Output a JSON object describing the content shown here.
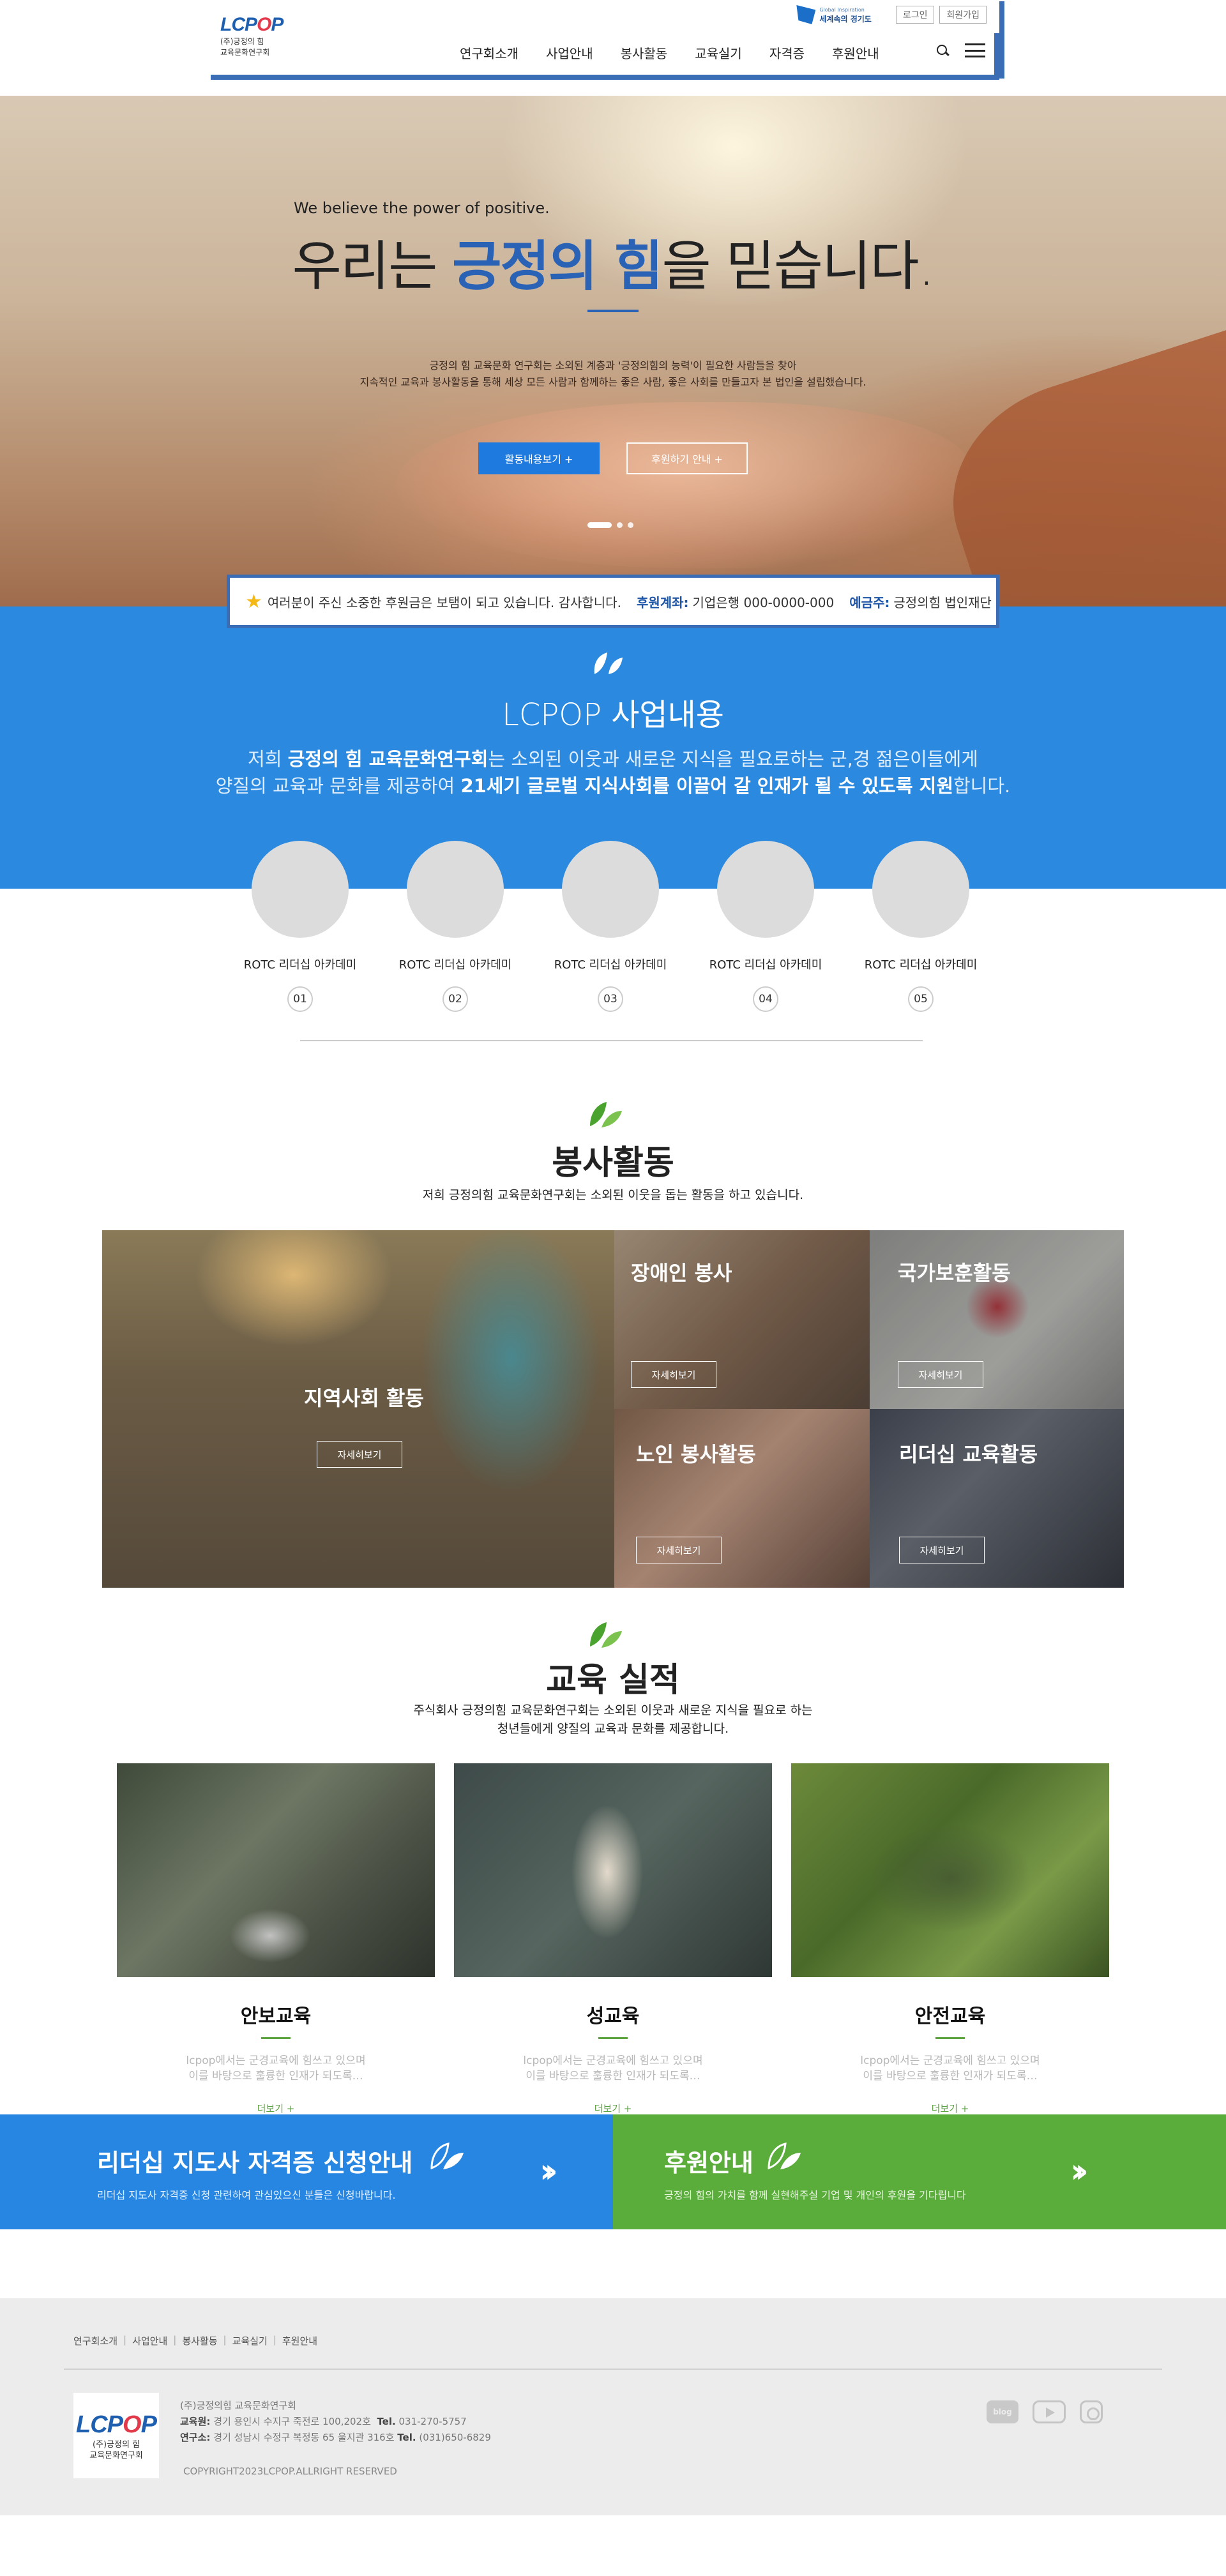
{
  "header": {
    "logo_main_1": "LCP",
    "logo_main_o": "O",
    "logo_main_2": "P",
    "logo_sub_1": "(주)긍정의 힘",
    "logo_sub_2": "교육문화연구회",
    "gyeonggi_small": "Global Inspiration",
    "gyeonggi_name": "세계속의 경기도",
    "login": "로그인",
    "signup": "회원가입",
    "nav": [
      "연구회소개",
      "사업안내",
      "봉사활동",
      "교육실기",
      "자격증",
      "후원안내"
    ]
  },
  "hero": {
    "eyebrow": "We believe the power of positive.",
    "title_pre": "우리는 ",
    "title_emph": "긍정의 힘",
    "title_post": "을 믿습니다.",
    "desc_1": "긍정의 힘 교육문화 연구회는 소외된 계층과 '긍정의힘의 능력'이 필요한 사람들을 찾아",
    "desc_2": "지속적인 교육과 봉사활동을 통해 세상 모든 사람과 함께하는 좋은 사람, 좋은 사회를 만들고자 본 법인을 설립했습니다.",
    "btn_activity": "활동내용보기 +",
    "btn_donate": "후원하기 안내 +"
  },
  "notice": {
    "text": "여러분이 주신 소중한 후원금은 보탬이 되고 있습니다. 감사합니다.",
    "account_label": "후원계좌:",
    "account_value": "기업은행 000-0000-000",
    "holder_label": "예금주:",
    "holder_value": "긍정의힘 법인재단"
  },
  "business": {
    "title": "LCPOP 사업내용",
    "line1_a": "저희 ",
    "line1_b": "긍정의 힘 교육문화연구회",
    "line1_c": "는 소외된 이웃과 새로운 지식을 필요로하는 군,경 젊은이들에게",
    "line2_a": "양질의 교육과 문화를 제공하여 ",
    "line2_b": "21세기 글로벌 지식사회를 이끌어 갈 인재가 될 수 있도록 지원",
    "line2_c": "합니다.",
    "items": [
      {
        "label": "ROTC 리더십 아카데미",
        "num": "01"
      },
      {
        "label": "ROTC 리더십 아카데미",
        "num": "02"
      },
      {
        "label": "ROTC 리더십 아카데미",
        "num": "03"
      },
      {
        "label": "ROTC 리더십 아카데미",
        "num": "04"
      },
      {
        "label": "ROTC 리더십 아카데미",
        "num": "05"
      }
    ]
  },
  "volunteer": {
    "title": "봉사활동",
    "subtitle": "저희 긍정의힘 교육문화연구회는 소외된 이웃을 돕는 활동을 하고 있습니다.",
    "tiles": [
      {
        "title": "지역사회 활동",
        "btn": "자세히보기"
      },
      {
        "title": "장애인 봉사",
        "btn": "자세히보기"
      },
      {
        "title": "국가보훈활동",
        "btn": "자세히보기"
      },
      {
        "title": "노인 봉사활동",
        "btn": "자세히보기"
      },
      {
        "title": "리더십 교육활동",
        "btn": "자세히보기"
      }
    ]
  },
  "education": {
    "title": "교육 실적",
    "sub_1": "주식회사 긍정의힘 교육문화연구회는 소외된 이웃과 새로운 지식을 필요로 하는",
    "sub_2": "청년들에게 양질의 교육과 문화를 제공합니다.",
    "cards": [
      {
        "name": "안보교육",
        "text_1": "lcpop에서는 군경교육에 힘쓰고 있으며",
        "text_2": "이를 바탕으로 훌륭한 인재가 되도록…",
        "more": "더보기 +"
      },
      {
        "name": "성교육",
        "text_1": "lcpop에서는 군경교육에 힘쓰고 있으며",
        "text_2": "이를 바탕으로 훌륭한 인재가 되도록…",
        "more": "더보기 +"
      },
      {
        "name": "안전교육",
        "text_1": "lcpop에서는 군경교육에 힘쓰고 있으며",
        "text_2": "이를 바탕으로 훌륭한 인재가 되도록…",
        "more": "더보기 +"
      }
    ]
  },
  "banners": {
    "cert_title": "리더십 지도사 자격증 신청안내",
    "cert_sub": "리더십 지도사 자격증 신청 관련하여 관심있으신 분들은 신청바랍니다.",
    "donate_title": "후원안내",
    "donate_sub": "긍정의 힘의 가치를 함께 실현해주실 기업 및 개인의 후원을 기다립니다"
  },
  "footer": {
    "links": [
      "연구회소개",
      "사업안내",
      "봉사활동",
      "교육실기",
      "후원안내"
    ],
    "company": "(주)긍정의힘 교육문화연구회",
    "edu_label": "교육원:",
    "edu_addr": "경기 용인시 수지구 죽전로 100,202호",
    "edu_tel_label": "Tel.",
    "edu_tel": "031-270-5757",
    "lab_label": "연구소:",
    "lab_addr": "경기 성남시 수정구 복정동 65 울지관 316호",
    "lab_tel_label": "Tel.",
    "lab_tel": "(031)650-6829",
    "copyright": "COPYRIGHT2023LCPOP.ALLRIGHT RESERVED",
    "sns_blog": "blog"
  },
  "colors": {
    "primary_blue": "#2b8ae0",
    "header_blue": "#3a6db5",
    "green": "#5aad3a"
  }
}
